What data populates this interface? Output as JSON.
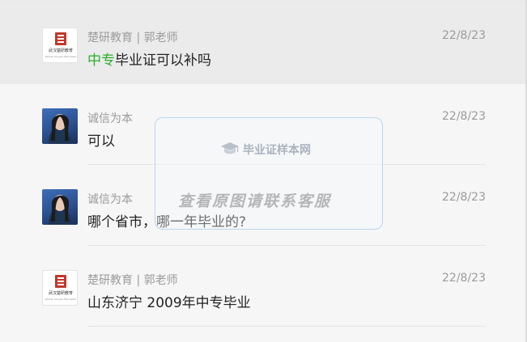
{
  "conversations": [
    {
      "name": "楚研教育 | 郭老师",
      "time": "22/8/23",
      "message_highlight": "中专",
      "message": "毕业证可以补吗",
      "avatar_icon": "school-logo-icon",
      "logo_label": "武汉楚研教育",
      "logo_subtext": "Wuhan Chuyan Education"
    },
    {
      "name": "诚信为本",
      "time": "22/8/23",
      "message": "可以",
      "avatar_icon": "user-photo-icon"
    },
    {
      "name": "诚信为本",
      "time": "22/8/23",
      "message": "哪个省市，哪一年毕业的?",
      "avatar_icon": "user-photo-icon"
    },
    {
      "name": "楚研教育 | 郭老师",
      "time": "22/8/23",
      "message": "山东济宁 2009年中专毕业",
      "avatar_icon": "school-logo-icon",
      "logo_label": "武汉楚研教育",
      "logo_subtext": "Wuhan Chuyan Education"
    }
  ],
  "watermark": {
    "brand": "毕业证样本网",
    "contact": "查看原图请联系客服",
    "icon": "graduation-cap-icon"
  },
  "colors": {
    "highlight": "#2aae2a",
    "active_row": "#ebebeb",
    "background": "#f6f6f6",
    "secondary_text": "#9b9b9b"
  }
}
